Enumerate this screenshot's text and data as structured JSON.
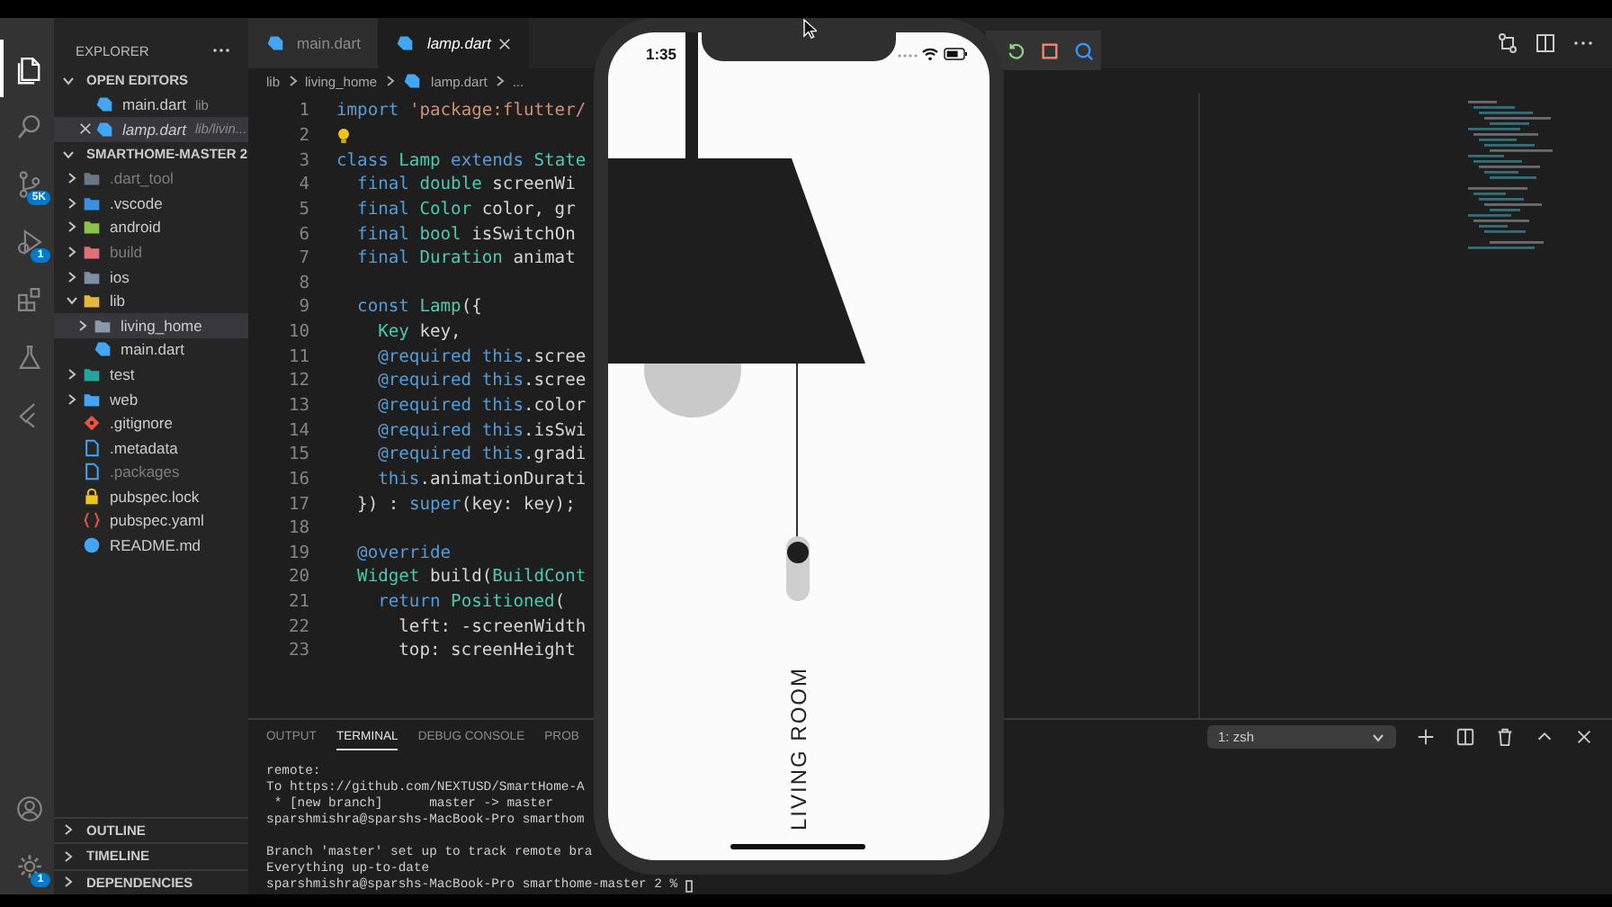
{
  "activity_bar": {
    "items": [
      {
        "kind": "files",
        "selected": true
      },
      {
        "kind": "search",
        "selected": false
      },
      {
        "kind": "source-control",
        "selected": false,
        "badge": "5K"
      },
      {
        "kind": "debug",
        "selected": false,
        "badge": "1"
      },
      {
        "kind": "extensions",
        "selected": false
      },
      {
        "kind": "testing",
        "selected": false
      },
      {
        "kind": "flutter",
        "selected": false
      }
    ],
    "bottom": [
      {
        "kind": "account"
      },
      {
        "kind": "settings",
        "badge": "1"
      }
    ]
  },
  "sidebar": {
    "title": "EXPLORER",
    "open_editors": {
      "title": "OPEN EDITORS",
      "expanded": true,
      "items": [
        {
          "name": "main.dart",
          "path": "lib",
          "selected": false,
          "preview": false
        },
        {
          "name": "lamp.dart",
          "path": "lib/livin...",
          "selected": true,
          "preview": true
        }
      ]
    },
    "project": {
      "title": "SMARTHOME-MASTER 2",
      "expanded": true,
      "tree": [
        {
          "name": ".dart_tool",
          "kind": "folder",
          "color": "#6b7785",
          "expanded": false,
          "dimmed": true,
          "selected": false
        },
        {
          "name": ".vscode",
          "kind": "folder",
          "color": "#3d8fe0",
          "expanded": false,
          "dimmed": false,
          "selected": false
        },
        {
          "name": "android",
          "kind": "folder",
          "color": "#8bc34a",
          "expanded": false,
          "dimmed": false,
          "selected": false
        },
        {
          "name": "build",
          "kind": "folder",
          "color": "#e0707a",
          "expanded": false,
          "dimmed": true,
          "selected": false
        },
        {
          "name": "ios",
          "kind": "folder",
          "color": "#7d8fa3",
          "expanded": false,
          "dimmed": false,
          "selected": false
        },
        {
          "name": "lib",
          "kind": "folder",
          "color": "#e2b93d",
          "expanded": true,
          "dimmed": false,
          "selected": false,
          "children": [
            {
              "name": "living_home",
              "kind": "folder",
              "color": "#8a9aab",
              "expanded": false,
              "dimmed": false,
              "selected": true
            },
            {
              "name": "main.dart",
              "kind": "dart",
              "color": "#42a5f5",
              "dimmed": false,
              "selected": false
            }
          ]
        },
        {
          "name": "test",
          "kind": "folder",
          "color": "#26a69a",
          "expanded": false,
          "dimmed": false,
          "selected": false
        },
        {
          "name": "web",
          "kind": "folder",
          "color": "#42a5f5",
          "expanded": false,
          "dimmed": false,
          "selected": false
        },
        {
          "name": ".gitignore",
          "kind": "git",
          "color": "#e8543f",
          "dimmed": false,
          "selected": false
        },
        {
          "name": ".metadata",
          "kind": "doc",
          "color": "#42a5f5",
          "dimmed": false,
          "selected": false
        },
        {
          "name": ".packages",
          "kind": "doc",
          "color": "#42a5f5",
          "dimmed": true,
          "selected": false
        },
        {
          "name": "pubspec.lock",
          "kind": "lock",
          "color": "#f0c419",
          "dimmed": false,
          "selected": false
        },
        {
          "name": "pubspec.yaml",
          "kind": "yaml",
          "color": "#e8543f",
          "dimmed": false,
          "selected": false
        },
        {
          "name": "README.md",
          "kind": "info",
          "color": "#42a5f5",
          "dimmed": false,
          "selected": false
        }
      ]
    },
    "sections": [
      {
        "title": "OUTLINE",
        "expanded": false
      },
      {
        "title": "TIMELINE",
        "expanded": false
      },
      {
        "title": "DEPENDENCIES",
        "expanded": false
      }
    ]
  },
  "editor": {
    "tabs": [
      {
        "label": "main.dart",
        "selected": false,
        "preview": false
      },
      {
        "label": "lamp.dart",
        "selected": true,
        "preview": true
      }
    ],
    "breadcrumb": [
      {
        "kind": "folder",
        "text": "lib"
      },
      {
        "kind": "folder",
        "text": "living_home"
      },
      {
        "kind": "dart",
        "text": "lamp.dart"
      },
      {
        "kind": "more",
        "text": "..."
      }
    ],
    "lines": [
      {
        "number": "1",
        "tokens": [
          {
            "kind": "kw",
            "text": "import "
          },
          {
            "kind": "str",
            "text": "'package:flutter/"
          }
        ]
      },
      {
        "number": "2",
        "lightbulb": true
      },
      {
        "number": "3",
        "tokens": [
          {
            "kind": "kw",
            "text": "class "
          },
          {
            "kind": "type",
            "text": "Lamp "
          },
          {
            "kind": "kw",
            "text": "extends "
          },
          {
            "kind": "type",
            "text": "State"
          }
        ]
      },
      {
        "number": "4",
        "tokens": [
          {
            "kind": "kw",
            "text": "  final "
          },
          {
            "kind": "type",
            "text": "double "
          },
          {
            "kind": "id",
            "text": "screenWi"
          }
        ]
      },
      {
        "number": "5",
        "tokens": [
          {
            "kind": "kw",
            "text": "  final "
          },
          {
            "kind": "type",
            "text": "Color "
          },
          {
            "kind": "id",
            "text": "color, gr"
          }
        ]
      },
      {
        "number": "6",
        "tokens": [
          {
            "kind": "kw",
            "text": "  final "
          },
          {
            "kind": "type",
            "text": "bool "
          },
          {
            "kind": "id",
            "text": "isSwitchOn"
          }
        ]
      },
      {
        "number": "7",
        "tokens": [
          {
            "kind": "kw",
            "text": "  final "
          },
          {
            "kind": "type",
            "text": "Duration "
          },
          {
            "kind": "id",
            "text": "animat"
          }
        ]
      },
      {
        "number": "8"
      },
      {
        "number": "9",
        "tokens": [
          {
            "kind": "kw",
            "text": "  const "
          },
          {
            "kind": "type",
            "text": "Lamp"
          },
          {
            "kind": "id",
            "text": "({"
          }
        ]
      },
      {
        "number": "10",
        "tokens": [
          {
            "kind": "type",
            "text": "    Key "
          },
          {
            "kind": "id",
            "text": "key,"
          }
        ]
      },
      {
        "number": "11",
        "tokens": [
          {
            "kind": "kw",
            "text": "    @required this"
          },
          {
            "kind": "id",
            "text": ".scree"
          }
        ]
      },
      {
        "number": "12",
        "tokens": [
          {
            "kind": "kw",
            "text": "    @required this"
          },
          {
            "kind": "id",
            "text": ".scree"
          }
        ]
      },
      {
        "number": "13",
        "tokens": [
          {
            "kind": "kw",
            "text": "    @required this"
          },
          {
            "kind": "id",
            "text": ".color"
          }
        ]
      },
      {
        "number": "14",
        "tokens": [
          {
            "kind": "kw",
            "text": "    @required this"
          },
          {
            "kind": "id",
            "text": ".isSwi"
          }
        ]
      },
      {
        "number": "15",
        "tokens": [
          {
            "kind": "kw",
            "text": "    @required this"
          },
          {
            "kind": "id",
            "text": ".gradi"
          }
        ]
      },
      {
        "number": "16",
        "tokens": [
          {
            "kind": "kw",
            "text": "    this"
          },
          {
            "kind": "id",
            "text": ".animationDurati"
          }
        ]
      },
      {
        "number": "17",
        "tokens": [
          {
            "kind": "id",
            "text": "  }) : "
          },
          {
            "kind": "kw",
            "text": "super"
          },
          {
            "kind": "id",
            "text": "(key: key);"
          }
        ]
      },
      {
        "number": "18"
      },
      {
        "number": "19",
        "tokens": [
          {
            "kind": "kw",
            "text": "  @override"
          }
        ]
      },
      {
        "number": "20",
        "tokens": [
          {
            "kind": "type",
            "text": "  Widget "
          },
          {
            "kind": "id",
            "text": "build("
          },
          {
            "kind": "type",
            "text": "BuildCont"
          }
        ]
      },
      {
        "number": "21",
        "tokens": [
          {
            "kind": "kw",
            "text": "    return "
          },
          {
            "kind": "type",
            "text": "Positioned"
          },
          {
            "kind": "id",
            "text": "("
          }
        ]
      },
      {
        "number": "22",
        "tokens": [
          {
            "kind": "id",
            "text": "      left: -screenWidth"
          }
        ]
      },
      {
        "number": "23",
        "tokens": [
          {
            "kind": "id",
            "text": "      top: screenHeight"
          }
        ]
      }
    ]
  },
  "panel": {
    "tabs": [
      {
        "label": "OUTPUT",
        "selected": false
      },
      {
        "label": "TERMINAL",
        "selected": true
      },
      {
        "label": "DEBUG CONSOLE",
        "selected": false
      },
      {
        "label": "PROB",
        "selected": false
      }
    ],
    "shell": "1: zsh",
    "blocks": [
      [
        "remote:",
        "To https://github.com/NEXTUSD/SmartHome-A",
        " * [new branch]      master -> master",
        "sparshmishra@sparshs-MacBook-Pro smarthom"
      ],
      [
        "Branch 'master' set up to track remote bra",
        "Everything up-to-date",
        "sparshmishra@sparshs-MacBook-Pro smarthome-master 2 % "
      ]
    ]
  },
  "phone": {
    "time": "1:35",
    "room": "LIVING ROOM",
    "lamp_on": false
  }
}
